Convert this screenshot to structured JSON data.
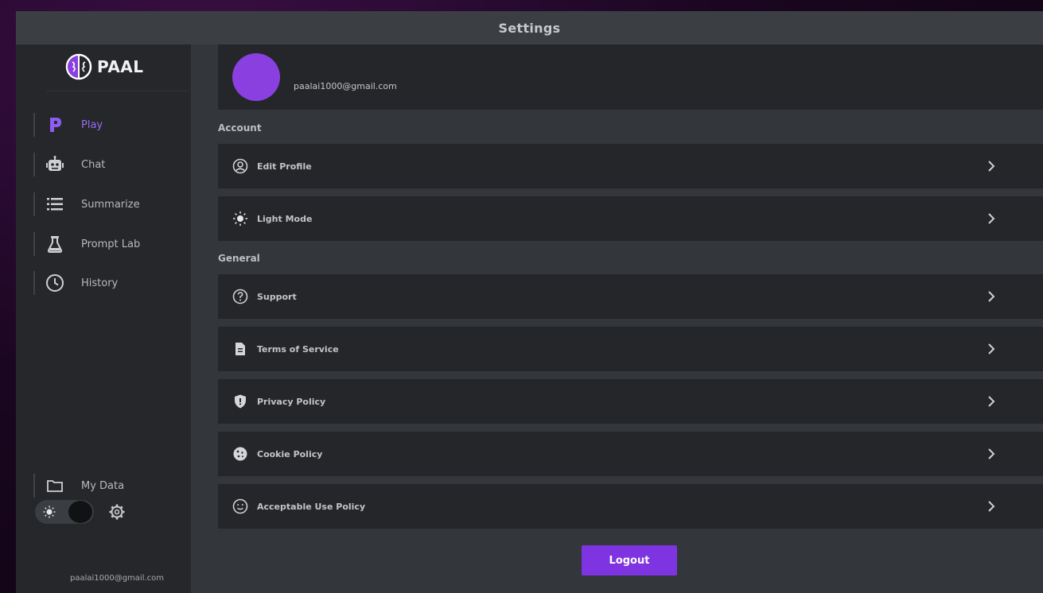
{
  "window": {
    "title": "Settings"
  },
  "sidebar": {
    "logo_text": "PAAL",
    "items": [
      {
        "label": "Play",
        "icon": "play-p-icon",
        "active": true
      },
      {
        "label": "Chat",
        "icon": "robot-icon"
      },
      {
        "label": "Summarize",
        "icon": "list-icon"
      },
      {
        "label": "Prompt Lab",
        "icon": "flask-icon"
      },
      {
        "label": "History",
        "icon": "clock-icon"
      }
    ],
    "my_data": {
      "label": "My Data",
      "icon": "folder-icon"
    },
    "theme": "dark",
    "email": "paalai1000@gmail.com"
  },
  "profile": {
    "email": "paalai1000@gmail.com",
    "avatar_color": "#8a3fe0"
  },
  "sections": {
    "account": {
      "title": "Account",
      "rows": [
        {
          "label": "Edit Profile",
          "icon": "user-circle-icon"
        },
        {
          "label": "Light Mode",
          "icon": "sun-icon"
        }
      ]
    },
    "general": {
      "title": "General",
      "rows": [
        {
          "label": "Support",
          "icon": "question-circle-icon"
        },
        {
          "label": "Terms of Service",
          "icon": "document-icon"
        },
        {
          "label": "Privacy Policy",
          "icon": "shield-icon"
        },
        {
          "label": "Cookie Policy",
          "icon": "cookie-icon"
        },
        {
          "label": "Acceptable Use Policy",
          "icon": "smile-icon"
        }
      ]
    }
  },
  "logout_label": "Logout",
  "colors": {
    "accent": "#7e34e0",
    "active_nav": "#9b6bf0",
    "panel": "#24262a",
    "background": "#33363b"
  }
}
